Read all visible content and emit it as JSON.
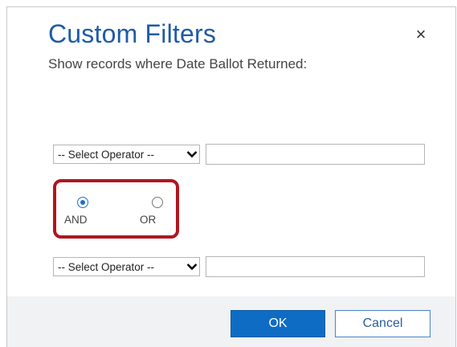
{
  "dialog": {
    "title": "Custom Filters",
    "subtitle": "Show records where Date Ballot Returned:",
    "close_symbol": "×"
  },
  "filter1": {
    "operator_label": "-- Select Operator --",
    "value": ""
  },
  "logic": {
    "and_label": "AND",
    "or_label": "OR",
    "selected": "AND"
  },
  "filter2": {
    "operator_label": "-- Select Operator --",
    "value": ""
  },
  "buttons": {
    "ok_label": "OK",
    "cancel_label": "Cancel"
  },
  "colors": {
    "title": "#1f5ba8",
    "primary": "#0e6cc4",
    "highlight": "#b2161f",
    "footer_bg": "#f0f2f4"
  },
  "icons": {
    "close": "close-icon",
    "chevron": "chevron-down-icon"
  }
}
